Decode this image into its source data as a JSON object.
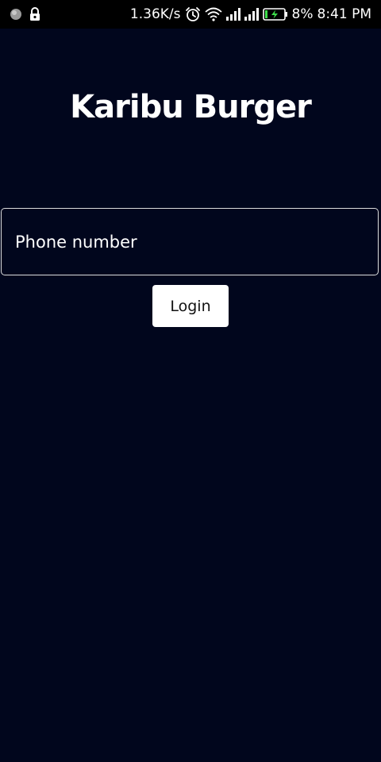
{
  "status_bar": {
    "network_speed": "1.36K/s",
    "battery_percent": "8%",
    "time": "8:41 PM",
    "icons": [
      "notification-dot-icon",
      "lock-icon",
      "alarm-icon",
      "wifi-icon",
      "signal-icon",
      "signal-icon",
      "battery-charging-icon"
    ]
  },
  "app": {
    "title": "Karibu Burger"
  },
  "login_form": {
    "phone_placeholder": "Phone number",
    "phone_value": "",
    "login_label": "Login"
  },
  "colors": {
    "background": "#01061d",
    "status_bar": "#000000",
    "button_bg": "#ffffff",
    "field_border": "#dcdcdc",
    "battery_charge": "#3ddc4a"
  }
}
